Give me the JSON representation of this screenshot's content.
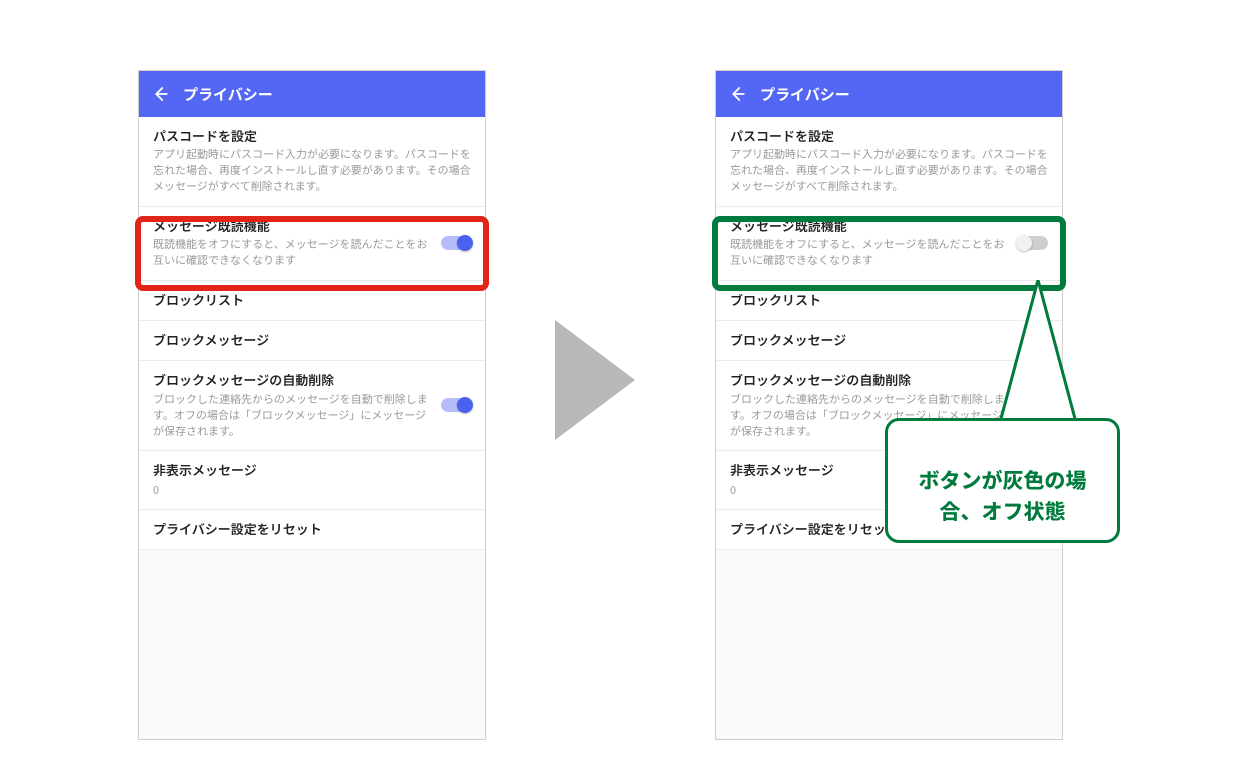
{
  "header": {
    "title": "プライバシー"
  },
  "rows": {
    "passcode": {
      "title": "パスコードを設定",
      "sub": "アプリ起動時にパスコード入力が必要になります。パスコードを忘れた場合、再度インストールし直す必要があります。その場合メッセージがすべて削除されます。"
    },
    "read_receipt": {
      "title": "メッセージ既読機能",
      "sub": "既読機能をオフにすると、メッセージを読んだことをお互いに確認できなくなります"
    },
    "blocklist": {
      "title": "ブロックリスト"
    },
    "blockmsg": {
      "title": "ブロックメッセージ"
    },
    "autodelete": {
      "title": "ブロックメッセージの自動削除",
      "sub": "ブロックした連絡先からのメッセージを自動で削除します。オフの場合は「ブロックメッセージ」にメッセージが保存されます。"
    },
    "hidden": {
      "title": "非表示メッセージ",
      "count": "0"
    },
    "reset": {
      "title": "プライバシー設定をリセット"
    }
  },
  "callout": {
    "text": "ボタンが灰色の場\n合、オフ状態"
  },
  "colors": {
    "accent": "#5367f4",
    "annotation_red": "#e1251b",
    "annotation_green": "#007a3d",
    "arrow_gray": "#b8b8b8"
  }
}
